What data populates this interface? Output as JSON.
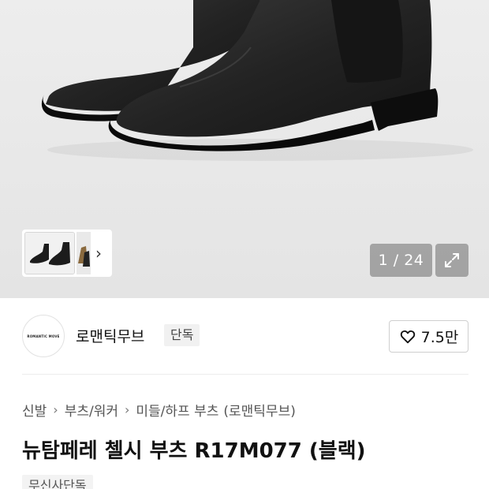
{
  "gallery": {
    "counter": "1 / 24",
    "expand_icon": "expand-arrows-icon",
    "next_icon": "chevron-right-icon"
  },
  "brand": {
    "logo_text": "ROMANTIC MOVE",
    "name": "로맨틱무브",
    "tag": "단독",
    "like_icon": "heart-outline-icon",
    "like_count": "7.5만"
  },
  "breadcrumb": {
    "items": [
      "신발",
      "부츠/워커",
      "미들/하프 부츠",
      "(로맨틱무브)"
    ],
    "separator_icon": "chevron-right-icon"
  },
  "product": {
    "title": "뉴탐페레 첼시 부츠 R17M077 (블랙)",
    "badge": "무신사단독"
  }
}
